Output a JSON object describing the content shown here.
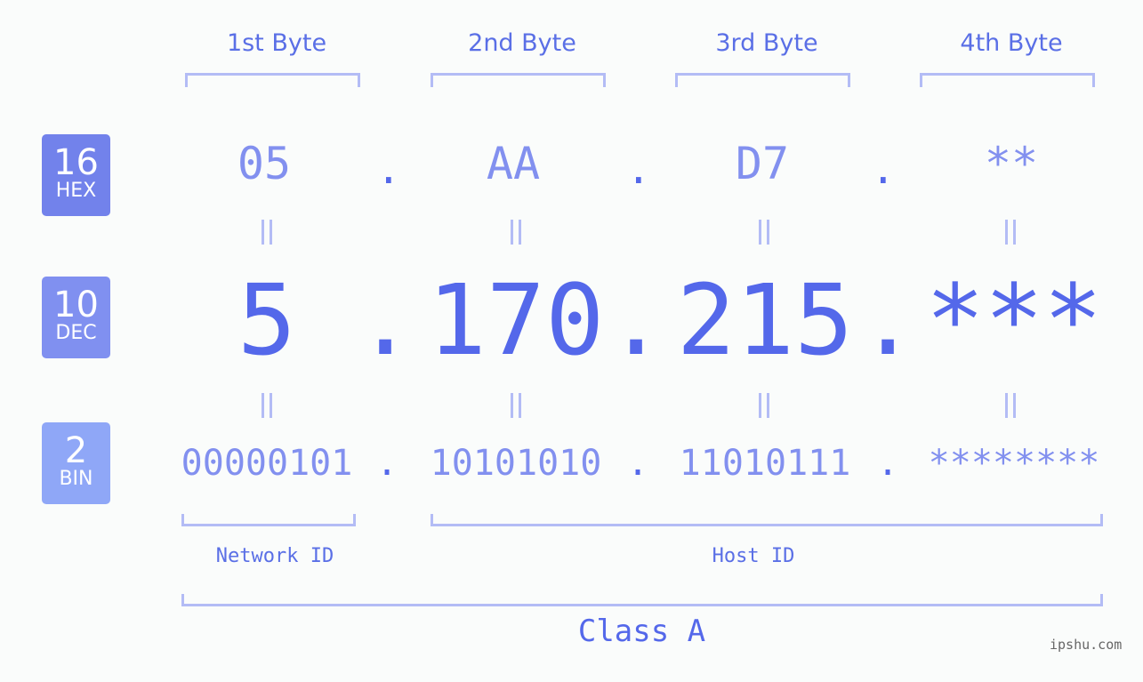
{
  "byte_headers": [
    "1st Byte",
    "2nd Byte",
    "3rd Byte",
    "4th Byte"
  ],
  "rows": {
    "hex": {
      "base": "16",
      "label": "HEX",
      "color": "#7282eb",
      "values": [
        "05",
        "AA",
        "D7",
        "**"
      ]
    },
    "dec": {
      "base": "10",
      "label": "DEC",
      "color": "#8090f0",
      "values": [
        "5",
        "170",
        "215",
        "***"
      ]
    },
    "bin": {
      "base": "2",
      "label": "BIN",
      "color": "#8fa7f7",
      "values": [
        "00000101",
        "10101010",
        "11010111",
        "********"
      ]
    }
  },
  "separator": ".",
  "network_id_label": "Network ID",
  "host_id_label": "Host ID",
  "class_label": "Class A",
  "brand": "ipshu.com",
  "colors": {
    "primary": "#5468ea",
    "light": "#8290ef",
    "bracket": "#b3bcf5"
  }
}
